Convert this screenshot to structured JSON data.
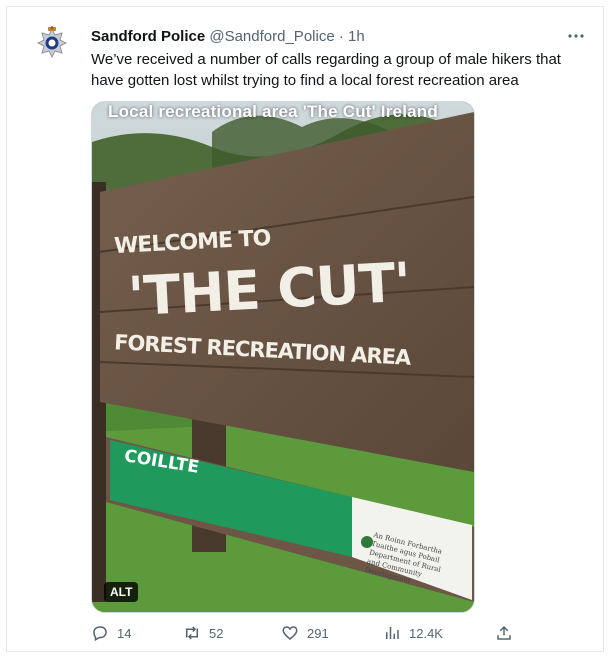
{
  "tweet": {
    "author_name": "Sandford Police",
    "handle": "@Sandford_Police",
    "separator": "·",
    "time": "1h",
    "text": "We’ve received a number of calls regarding a group of male hikers that have gotten lost whilst trying to find a local forest recreation area",
    "avatar_icon": "police-badge-icon",
    "more_icon": "more-dots-icon"
  },
  "media": {
    "caption": "Local recreational area 'The Cut' Ireland",
    "alt_label": "ALT",
    "sign": {
      "line1": "WELCOME TO",
      "line2": "'THE CUT'",
      "line3": "FOREST RECREATION AREA",
      "brand": "COILLTE",
      "gov_text": "An Roinn Forbartha Tuaithe agus Pobail Department of Rural and Community Development"
    },
    "colors": {
      "wood": "#6b5646",
      "grass": "#4f8a34",
      "sign_green": "#1f9a5c"
    }
  },
  "actions": {
    "reply": {
      "icon": "reply-icon",
      "count": "14"
    },
    "retweet": {
      "icon": "retweet-icon",
      "count": "52"
    },
    "like": {
      "icon": "heart-icon",
      "count": "291"
    },
    "views": {
      "icon": "views-icon",
      "count": "12.4K"
    },
    "share": {
      "icon": "share-icon"
    }
  }
}
